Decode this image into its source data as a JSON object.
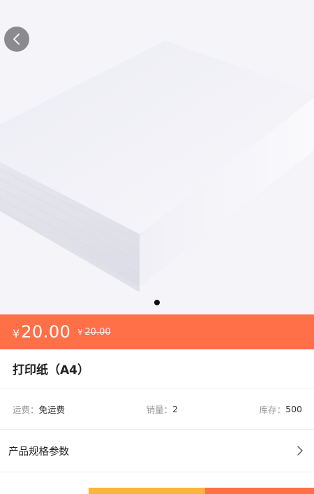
{
  "product": {
    "price_currency": "¥",
    "price": "20.00",
    "original_price_currency": "¥",
    "original_price": "20.00",
    "title": "打印纸（A4）"
  },
  "meta": {
    "shipping_label": "运费：",
    "shipping_value": "免运费",
    "sales_label": "销量：",
    "sales_value": "2",
    "stock_label": "库存：",
    "stock_value": "500"
  },
  "specs": {
    "label": "产品规格参数"
  },
  "carousel": {
    "total": 1,
    "active": 1
  },
  "colors": {
    "accent": "#ff6f48",
    "secondary": "#fdb43a"
  },
  "icons": {
    "back": "chevron-left-icon",
    "specs": "chevron-right-icon"
  }
}
